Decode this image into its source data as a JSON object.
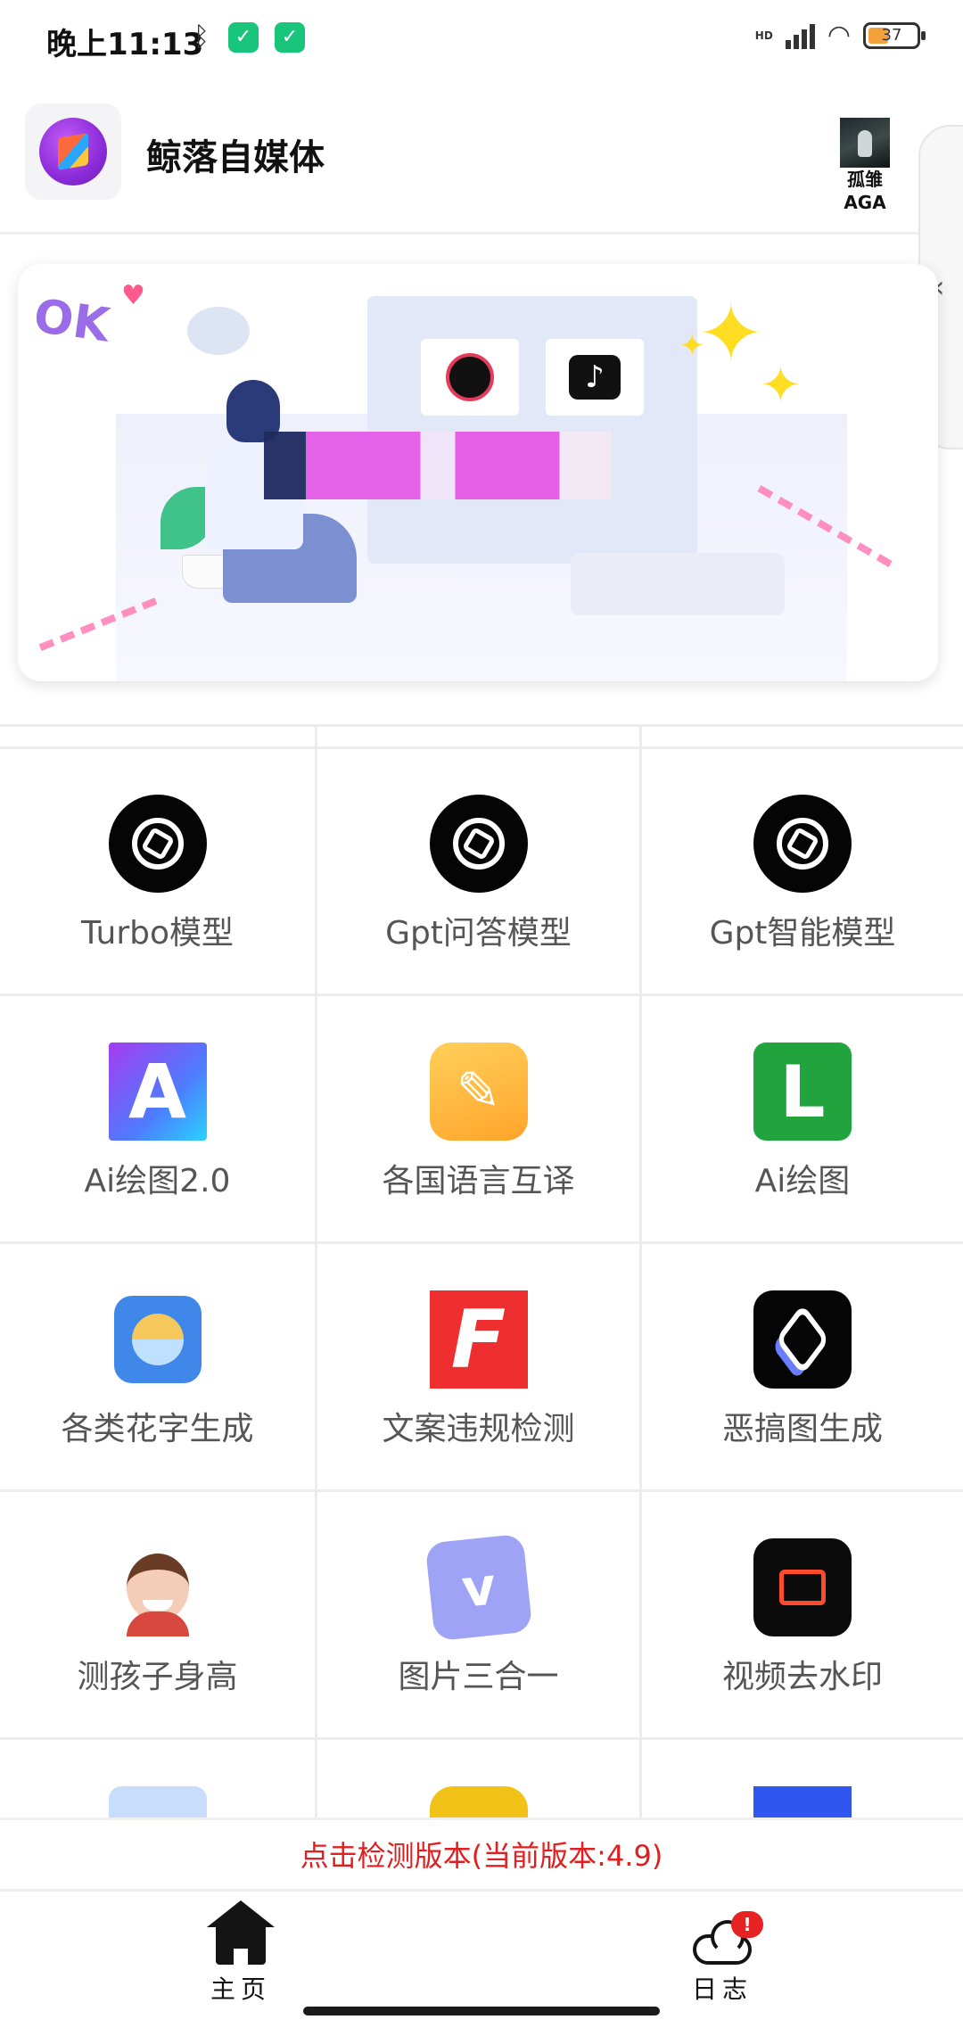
{
  "status_bar": {
    "time": "晚上11:13",
    "network": "HD",
    "battery": "37"
  },
  "header": {
    "app_title": "鲸落自媒体",
    "user_name_line1": "孤雏",
    "user_name_line2": "AGA"
  },
  "tools": [
    {
      "label": "Turbo模型",
      "icon": "openai-icon"
    },
    {
      "label": "Gpt问答模型",
      "icon": "openai-icon"
    },
    {
      "label": "Gpt智能模型",
      "icon": "openai-icon"
    },
    {
      "label": "Ai绘图2.0",
      "icon": "letter-a-icon"
    },
    {
      "label": "各国语言互译",
      "icon": "pencil-note-icon"
    },
    {
      "label": "Ai绘图",
      "icon": "letter-l-icon"
    },
    {
      "label": "各类花字生成",
      "icon": "sunrise-icon"
    },
    {
      "label": "文案违规检测",
      "icon": "letter-f-icon"
    },
    {
      "label": "恶搞图生成",
      "icon": "layers-icon"
    },
    {
      "label": "测孩子身高",
      "icon": "child-avatar-icon"
    },
    {
      "label": "图片三合一",
      "icon": "letter-v-icon"
    },
    {
      "label": "视频去水印",
      "icon": "video-camera-icon"
    }
  ],
  "version_check": "点击检测版本(当前版本:4.9)",
  "bottom_nav": {
    "home_label": "主页",
    "log_label": "日志",
    "log_badge": "!"
  }
}
